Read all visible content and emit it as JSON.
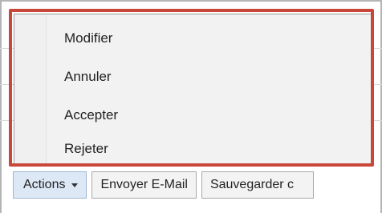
{
  "menu": {
    "items": [
      {
        "label": "Modifier"
      },
      {
        "label": "Annuler"
      },
      {
        "label": "Accepter"
      },
      {
        "label": "Rejeter"
      }
    ]
  },
  "toolbar": {
    "actions_label": "Actions",
    "send_email_label": "Envoyer E-Mail",
    "save_label": "Sauvegarder c"
  },
  "colors": {
    "highlight": "#c9473a",
    "actions_bg": "#dce8f5"
  }
}
